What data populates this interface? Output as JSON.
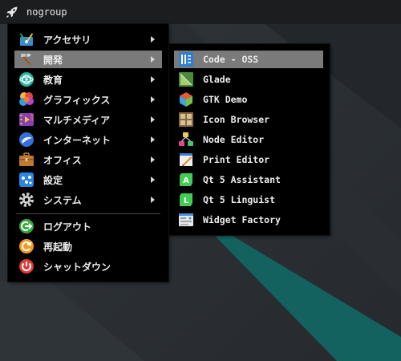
{
  "panel": {
    "title": "nogroup",
    "launcher_icon": "rocket-icon"
  },
  "main_menu": {
    "items": [
      {
        "label": "アクセサリ",
        "icon": "accessories-icon",
        "submenu": true
      },
      {
        "label": "開発",
        "icon": "development-icon",
        "submenu": true,
        "selected": true
      },
      {
        "label": "教育",
        "icon": "education-icon",
        "submenu": true
      },
      {
        "label": "グラフィックス",
        "icon": "graphics-icon",
        "submenu": true
      },
      {
        "label": "マルチメディア",
        "icon": "multimedia-icon",
        "submenu": true
      },
      {
        "label": "インターネット",
        "icon": "internet-icon",
        "submenu": true
      },
      {
        "label": "オフィス",
        "icon": "office-icon",
        "submenu": true
      },
      {
        "label": "設定",
        "icon": "settings-icon",
        "submenu": true
      },
      {
        "label": "システム",
        "icon": "system-icon",
        "submenu": true
      }
    ],
    "session": [
      {
        "label": "ログアウト",
        "icon": "logout-icon"
      },
      {
        "label": "再起動",
        "icon": "reboot-icon"
      },
      {
        "label": "シャットダウン",
        "icon": "shutdown-icon"
      }
    ]
  },
  "dev_submenu": {
    "items": [
      {
        "label": "Code - OSS",
        "icon": "code-oss-icon",
        "selected": true
      },
      {
        "label": "Glade",
        "icon": "glade-icon"
      },
      {
        "label": "GTK Demo",
        "icon": "gtk-demo-icon"
      },
      {
        "label": "Icon Browser",
        "icon": "icon-browser-icon"
      },
      {
        "label": "Node Editor",
        "icon": "node-editor-icon"
      },
      {
        "label": "Print Editor",
        "icon": "print-editor-icon"
      },
      {
        "label": "Qt 5 Assistant",
        "icon": "qt-assistant-icon"
      },
      {
        "label": "Qt 5 Linguist",
        "icon": "qt-linguist-icon"
      },
      {
        "label": "Widget Factory",
        "icon": "widget-factory-icon"
      }
    ]
  },
  "colors": {
    "wallpaper_dark": "#2c3034",
    "wallpaper_teal": "#14625f",
    "menu_bg": "#000000",
    "selection": "#7a7a7a",
    "panel_bg": "#1b1d1f"
  }
}
